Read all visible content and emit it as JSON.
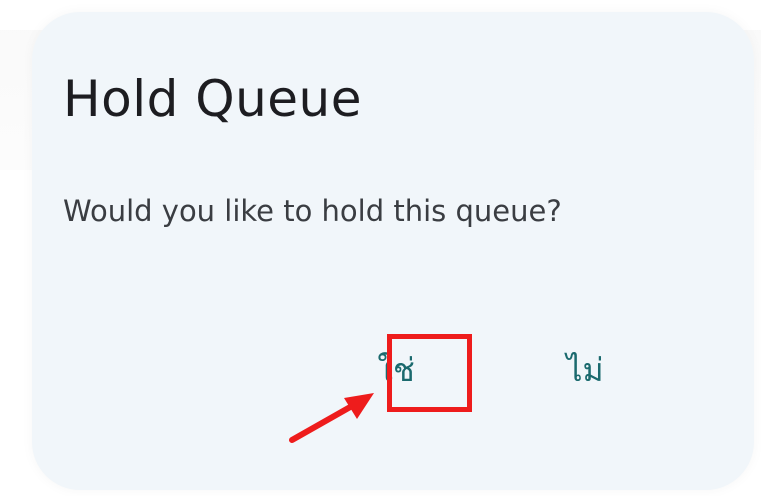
{
  "dialog": {
    "title": "Hold Queue",
    "message": "Would you like to hold this queue?",
    "confirm_label": "ใช่",
    "cancel_label": "ไม่"
  },
  "colors": {
    "dialog_background": "#f1f6fa",
    "title_text": "#1d1d21",
    "message_text": "#3a3d42",
    "button_text": "#1b6a6e",
    "annotation": "#ee1c1c"
  },
  "annotation": {
    "target": "confirm-button",
    "style": "red-box-with-arrow"
  }
}
